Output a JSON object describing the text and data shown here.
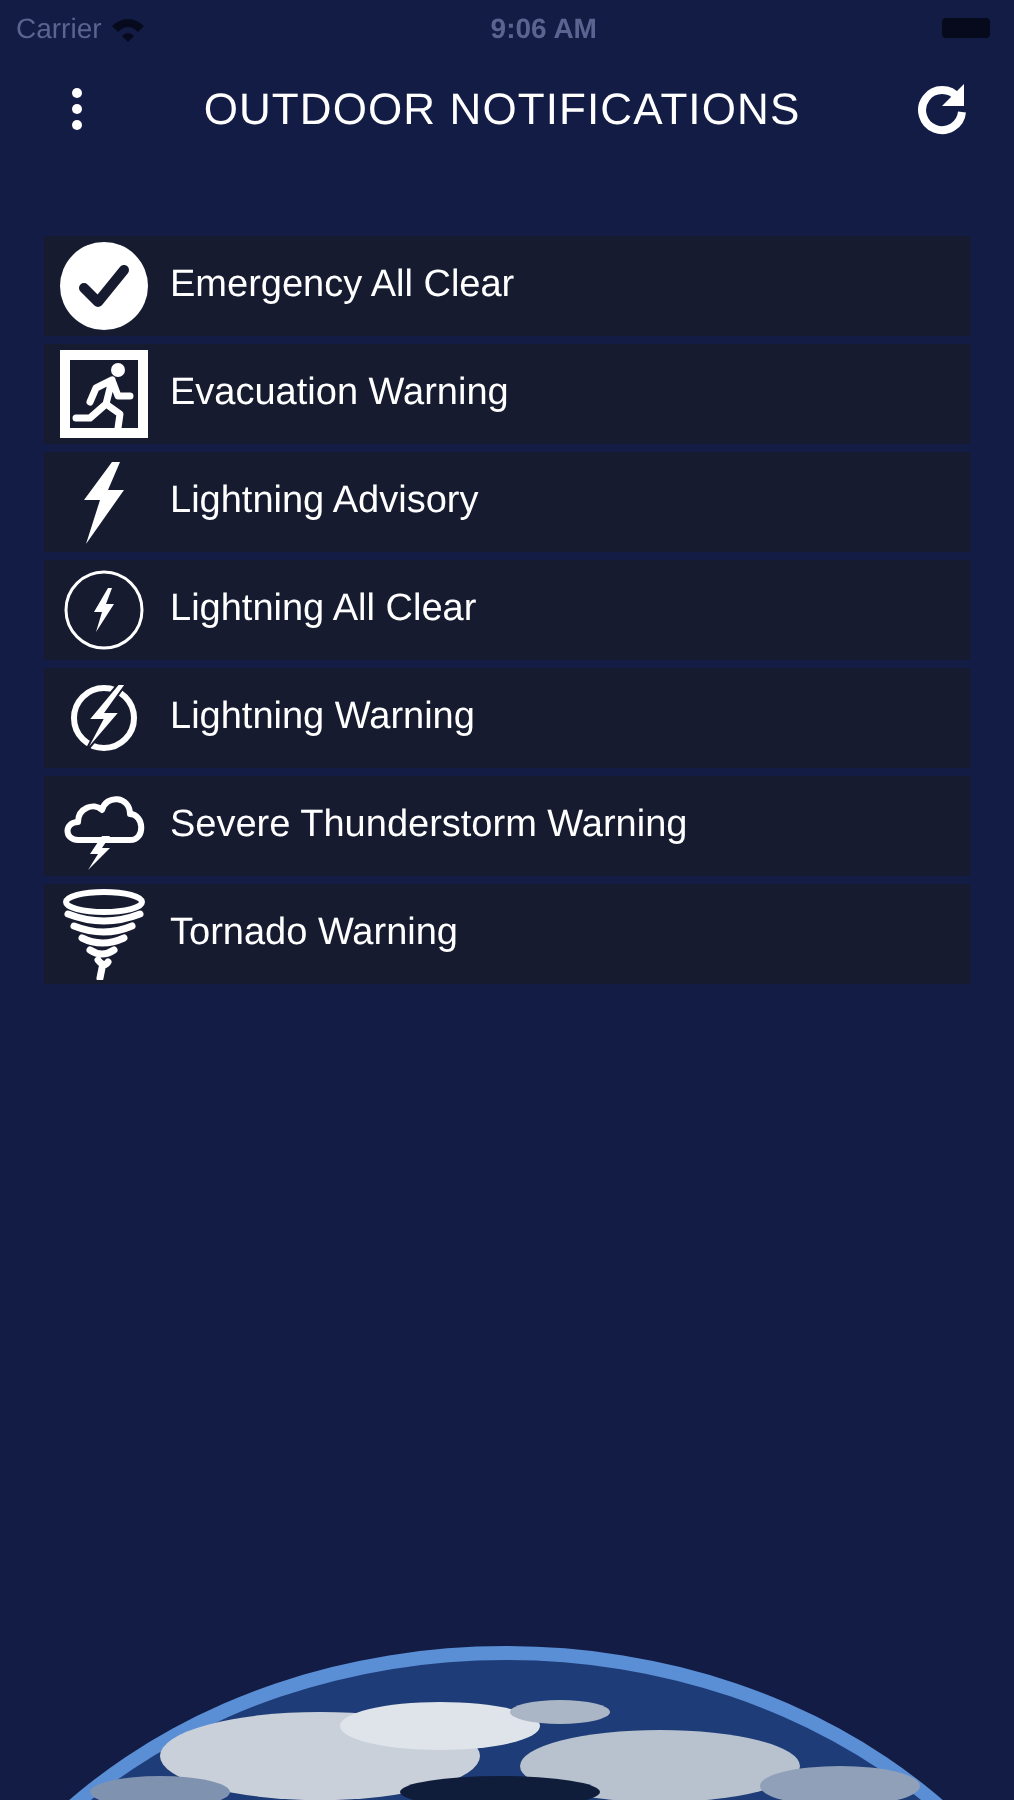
{
  "status_bar": {
    "carrier": "Carrier",
    "time": "9:06 AM"
  },
  "header": {
    "title": "OUTDOOR NOTIFICATIONS"
  },
  "notifications": [
    {
      "label": "Emergency All Clear",
      "kind": "check"
    },
    {
      "label": "Evacuation Warning",
      "kind": "exit"
    },
    {
      "label": "Lightning Advisory",
      "kind": "bolt"
    },
    {
      "label": "Lightning All Clear",
      "kind": "bolt-circle"
    },
    {
      "label": "Lightning Warning",
      "kind": "bolt-crossed"
    },
    {
      "label": "Severe Thunderstorm Warning",
      "kind": "storm"
    },
    {
      "label": "Tornado Warning",
      "kind": "tornado"
    }
  ]
}
